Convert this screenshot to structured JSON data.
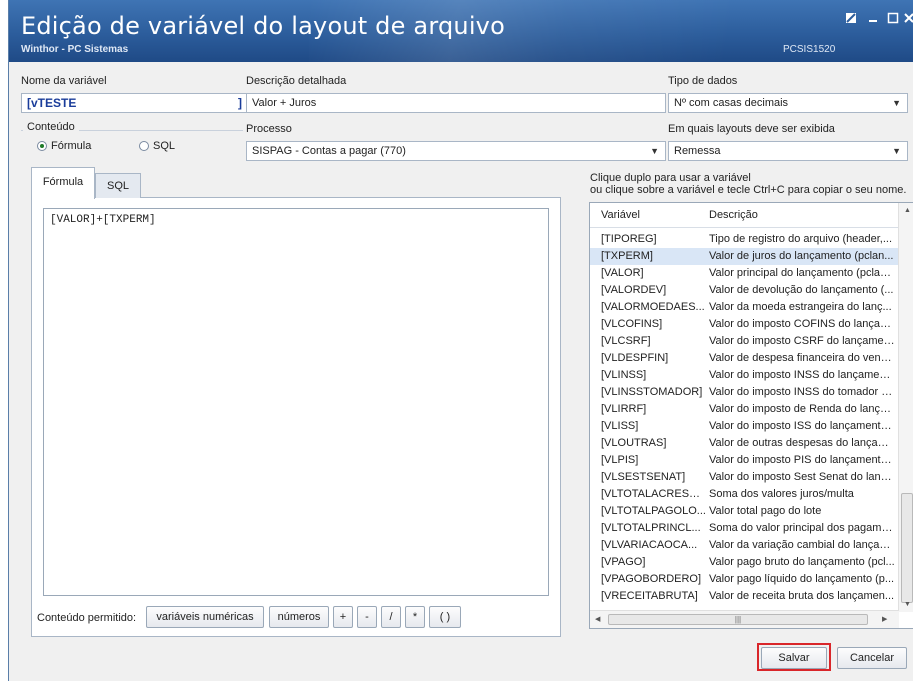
{
  "window": {
    "title": "Edição de variável do layout de arquivo",
    "subtitle": "Winthor - PC Sistemas",
    "code": "PCSIS1520"
  },
  "form": {
    "nome_label": "Nome da variável",
    "nome_value": "[vTESTE",
    "nome_bracket": "]",
    "descricao_label": "Descrição detalhada",
    "descricao_value": "Valor + Juros",
    "tipo_label": "Tipo de dados",
    "tipo_value": "Nº com casas decimais",
    "conteudo_label": "Conteúdo",
    "radio_formula": "Fórmula",
    "radio_sql": "SQL",
    "processo_label": "Processo",
    "processo_value": "SISPAG - Contas a pagar (770)",
    "layouts_label": "Em quais layouts deve ser exibida",
    "layouts_value": "Remessa"
  },
  "tabs": [
    {
      "label": "Fórmula"
    },
    {
      "label": "SQL"
    }
  ],
  "editor": {
    "content": "[VALOR]+[TXPERM]"
  },
  "allowed": {
    "label": "Conteúdo permitido:",
    "variaveis": "variáveis numéricas",
    "numeros": "números",
    "ops": [
      "+",
      "-",
      "/",
      "*",
      "( )"
    ]
  },
  "hint": {
    "line1": "Clique duplo para usar a variável",
    "line2": "ou clique sobre a variável e tecle Ctrl+C para copiar o seu nome."
  },
  "list": {
    "col1": "Variável",
    "col2": "Descrição",
    "selected_index": 1,
    "rows": [
      {
        "v": "[TIPOREG]",
        "d": "Tipo de registro do arquivo (header,..."
      },
      {
        "v": "[TXPERM]",
        "d": "Valor de juros do lançamento (pclan..."
      },
      {
        "v": "[VALOR]",
        "d": "Valor principal do lançamento (pclan..."
      },
      {
        "v": "[VALORDEV]",
        "d": "Valor de devolução do lançamento (..."
      },
      {
        "v": "[VALORMOEDAES...",
        "d": "Valor da moeda estrangeira do lanç..."
      },
      {
        "v": "[VLCOFINS]",
        "d": "Valor do imposto COFINS do lançam..."
      },
      {
        "v": "[VLCSRF]",
        "d": "Valor do imposto CSRF do lançamen..."
      },
      {
        "v": "[VLDESPFIN]",
        "d": "Valor de despesa financeira do vend..."
      },
      {
        "v": "[VLINSS]",
        "d": "Valor do imposto INSS do lançament..."
      },
      {
        "v": "[VLINSSTOMADOR]",
        "d": "Valor do imposto INSS do tomador d..."
      },
      {
        "v": "[VLIRRF]",
        "d": "Valor do imposto de Renda do lança..."
      },
      {
        "v": "[VLISS]",
        "d": "Valor do imposto ISS do lançamento ..."
      },
      {
        "v": "[VLOUTRAS]",
        "d": "Valor de outras despesas do lançam..."
      },
      {
        "v": "[VLPIS]",
        "d": "Valor do imposto PIS do lançamento ..."
      },
      {
        "v": "[VLSESTSENAT]",
        "d": "Valor do imposto Sest Senat do lanç..."
      },
      {
        "v": "[VLTOTALACRESC...",
        "d": "Soma dos valores juros/multa"
      },
      {
        "v": "[VLTOTALPAGOLO...",
        "d": "Valor total pago do lote"
      },
      {
        "v": "[VLTOTALPRINCL...",
        "d": "Soma do valor principal dos pagame..."
      },
      {
        "v": "[VLVARIACAOCA...",
        "d": "Valor da variação cambial do lançam..."
      },
      {
        "v": "[VPAGO]",
        "d": "Valor pago bruto do lançamento (pcl..."
      },
      {
        "v": "[VPAGOBORDERO]",
        "d": "Valor pago líquido do lançamento (p..."
      },
      {
        "v": "[VRECEITABRUTA]",
        "d": "Valor de receita bruta dos lançamen..."
      }
    ]
  },
  "buttons": {
    "salvar": "Salvar",
    "cancelar": "Cancelar"
  }
}
